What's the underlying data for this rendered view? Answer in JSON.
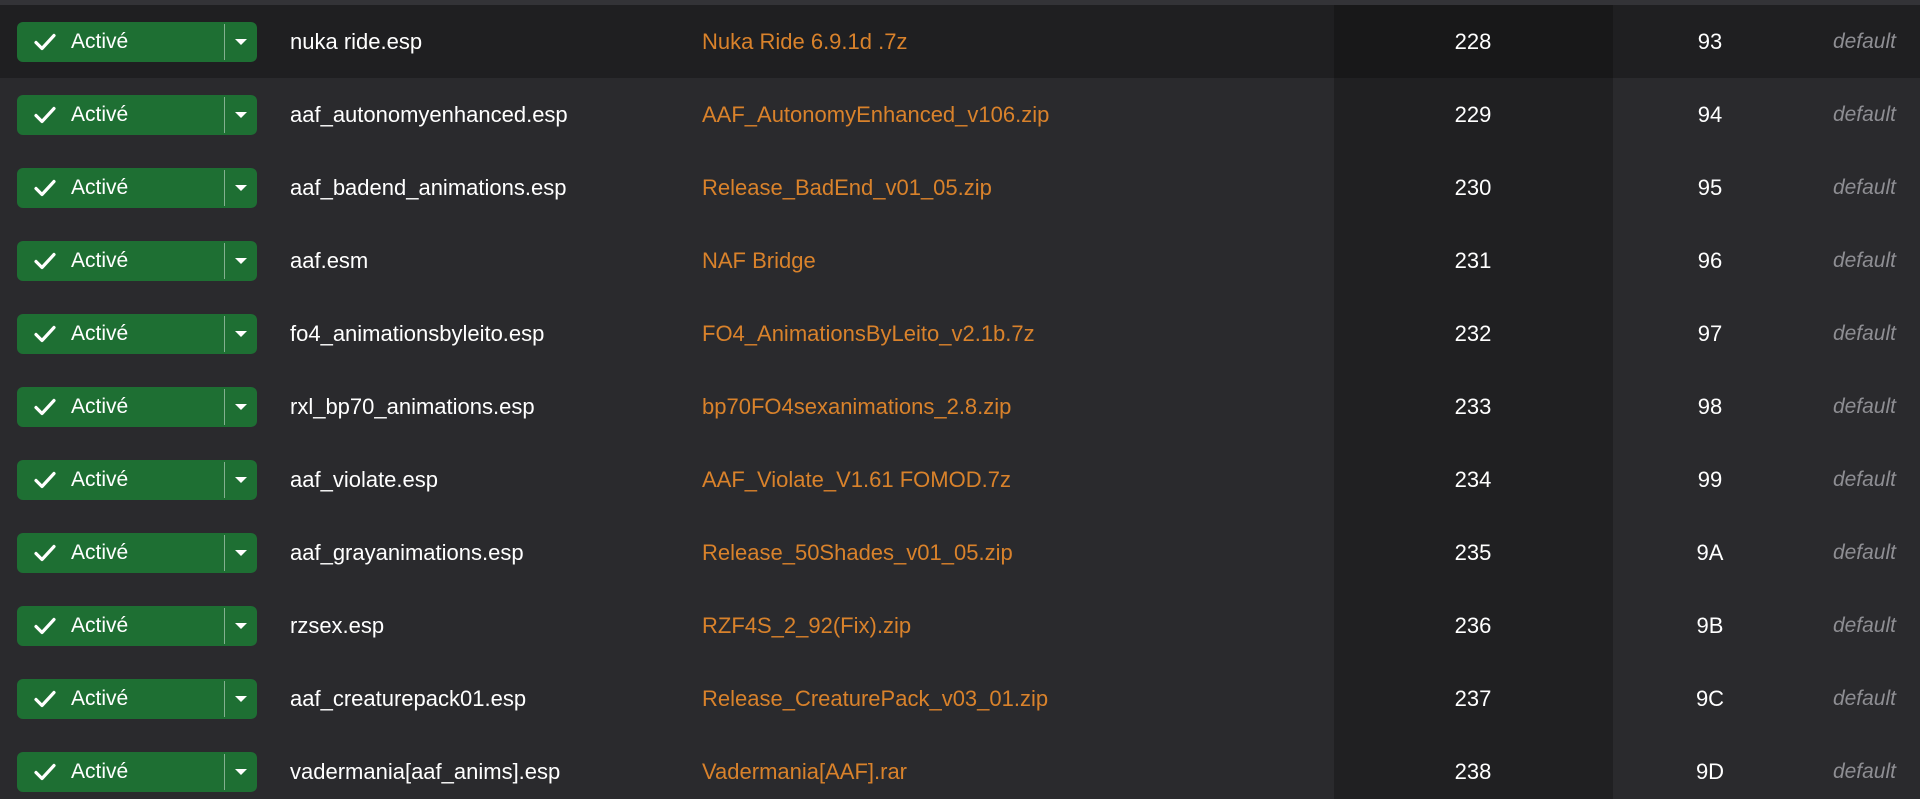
{
  "colors": {
    "background": "#2a2a2d",
    "status_active": "#1e6f33",
    "mod_link": "#d9822b",
    "profile_text": "#8e8e93"
  },
  "rows": [
    {
      "status": "Activé",
      "plugin": "nuka ride.esp",
      "mod": "Nuka Ride 6.9.1d .7z",
      "priority": "228",
      "index": "93",
      "profile": "default"
    },
    {
      "status": "Activé",
      "plugin": "aaf_autonomyenhanced.esp",
      "mod": "AAF_AutonomyEnhanced_v106.zip",
      "priority": "229",
      "index": "94",
      "profile": "default"
    },
    {
      "status": "Activé",
      "plugin": "aaf_badend_animations.esp",
      "mod": "Release_BadEnd_v01_05.zip",
      "priority": "230",
      "index": "95",
      "profile": "default"
    },
    {
      "status": "Activé",
      "plugin": "aaf.esm",
      "mod": "NAF Bridge",
      "priority": "231",
      "index": "96",
      "profile": "default"
    },
    {
      "status": "Activé",
      "plugin": "fo4_animationsbyleito.esp",
      "mod": "FO4_AnimationsByLeito_v2.1b.7z",
      "priority": "232",
      "index": "97",
      "profile": "default"
    },
    {
      "status": "Activé",
      "plugin": "rxl_bp70_animations.esp",
      "mod": "bp70FO4sexanimations_2.8.zip",
      "priority": "233",
      "index": "98",
      "profile": "default"
    },
    {
      "status": "Activé",
      "plugin": "aaf_violate.esp",
      "mod": "AAF_Violate_V1.61 FOMOD.7z",
      "priority": "234",
      "index": "99",
      "profile": "default"
    },
    {
      "status": "Activé",
      "plugin": "aaf_grayanimations.esp",
      "mod": "Release_50Shades_v01_05.zip",
      "priority": "235",
      "index": "9A",
      "profile": "default"
    },
    {
      "status": "Activé",
      "plugin": "rzsex.esp",
      "mod": "RZF4S_2_92(Fix).zip",
      "priority": "236",
      "index": "9B",
      "profile": "default"
    },
    {
      "status": "Activé",
      "plugin": "aaf_creaturepack01.esp",
      "mod": "Release_CreaturePack_v03_01.zip",
      "priority": "237",
      "index": "9C",
      "profile": "default"
    },
    {
      "status": "Activé",
      "plugin": "vadermania[aaf_anims].esp",
      "mod": "Vadermania[AAF].rar",
      "priority": "238",
      "index": "9D",
      "profile": "default"
    }
  ]
}
